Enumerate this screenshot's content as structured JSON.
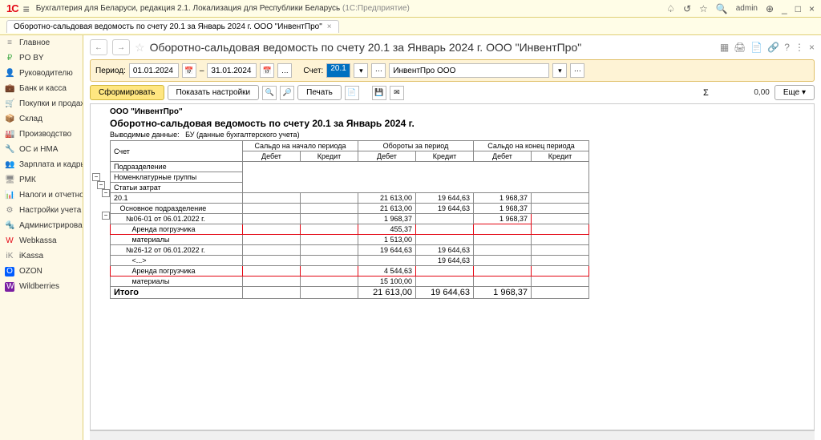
{
  "appbar": {
    "logo": "1С",
    "title_main": "Бухгалтерия для Беларуси, редакция 2.1. Локализация для Республики Беларусь",
    "title_gray": "(1С:Предприятие)",
    "user": "admin"
  },
  "tab": {
    "label": "Оборотно-сальдовая ведомость по счету 20.1 за Январь 2024 г. ООО \"ИнвентПро\""
  },
  "sidebar": [
    {
      "icon": "≡",
      "label": "Главное",
      "cls": "c-gray"
    },
    {
      "icon": "₽",
      "label": "PO BY",
      "cls": "c-green"
    },
    {
      "icon": "👤",
      "label": "Руководителю",
      "cls": "c-gray"
    },
    {
      "icon": "💼",
      "label": "Банк и касса",
      "cls": "c-green"
    },
    {
      "icon": "🛒",
      "label": "Покупки и продажи",
      "cls": "c-blue"
    },
    {
      "icon": "📦",
      "label": "Склад",
      "cls": "c-orange"
    },
    {
      "icon": "🏭",
      "label": "Производство",
      "cls": "c-purple"
    },
    {
      "icon": "🔧",
      "label": "ОС и НМА",
      "cls": "c-red"
    },
    {
      "icon": "👥",
      "label": "Зарплата и кадры",
      "cls": "c-blue"
    },
    {
      "icon": "🖥",
      "label": "РМК",
      "cls": "c-gray"
    },
    {
      "icon": "📊",
      "label": "Налоги и отчетность",
      "cls": "c-green"
    },
    {
      "icon": "⚙",
      "label": "Настройки учета",
      "cls": "c-gray"
    },
    {
      "icon": "🔩",
      "label": "Администрирование",
      "cls": "c-gray"
    },
    {
      "icon": "W",
      "label": "Webkassa",
      "cls": "c-red"
    },
    {
      "icon": "iK",
      "label": "iKassa",
      "cls": "c-gray"
    },
    {
      "icon": "O",
      "label": "OZON",
      "cls": "c-ozon"
    },
    {
      "icon": "W",
      "label": "Wildberries",
      "cls": "c-wb"
    }
  ],
  "page_title": "Оборотно-сальдовая ведомость по счету 20.1 за Январь 2024 г. ООО \"ИнвентПро\"",
  "filter": {
    "period_label": "Период:",
    "date_from": "01.01.2024",
    "date_to": "31.01.2024",
    "dash": "–",
    "account_label": "Счет:",
    "account": "20.1",
    "org": "ИнвентПро ООО"
  },
  "toolbar": {
    "form": "Сформировать",
    "settings": "Показать настройки",
    "print": "Печать",
    "more": "Еще",
    "sum_label": "Σ",
    "sum_value": "0,00"
  },
  "report": {
    "org": "ООО \"ИнвентПро\"",
    "title": "Оборотно-сальдовая ведомость по счету 20.1 за Январь 2024 г.",
    "meta_label": "Выводимые данные:",
    "meta_val": "БУ (данные бухгалтерского учета)",
    "cols": {
      "account": "Счет",
      "saldo_begin": "Сальдо на начало периода",
      "turnover": "Обороты за период",
      "saldo_end": "Сальдо на конец периода",
      "debit": "Дебет",
      "credit": "Кредит",
      "sub1": "Подразделение",
      "sub2": "Номенклатурные группы",
      "sub3": "Статьи затрат"
    },
    "rows": [
      {
        "name": "20.1",
        "d1": "",
        "c1": "",
        "d2": "21 613,00",
        "c2": "19 644,63",
        "d3": "1 968,37",
        "c3": ""
      },
      {
        "name": "Основное подразделение",
        "indent": 1,
        "d2": "21 613,00",
        "c2": "19 644,63",
        "d3": "1 968,37"
      },
      {
        "name": "№06-01 от 06.01.2022 г.",
        "indent": 2,
        "d2": "1 968,37",
        "d3": "1 968,37",
        "hlcell": "d3"
      },
      {
        "name": "Аренда погрузчика",
        "indent": 3,
        "hl": true,
        "d2": "455,37"
      },
      {
        "name": "материалы",
        "indent": 3,
        "d2": "1 513,00"
      },
      {
        "name": "№26-12 от 06.01.2022 г.",
        "indent": 2,
        "d2": "19 644,63",
        "c2": "19 644,63"
      },
      {
        "name": "<...>",
        "indent": 3,
        "c2": "19 644,63"
      },
      {
        "name": "Аренда погрузчика",
        "indent": 3,
        "hl": true,
        "d2": "4 544,63"
      },
      {
        "name": "материалы",
        "indent": 3,
        "d2": "15 100,00"
      }
    ],
    "total": {
      "label": "Итого",
      "d2": "21 613,00",
      "c2": "19 644,63",
      "d3": "1 968,37"
    }
  }
}
